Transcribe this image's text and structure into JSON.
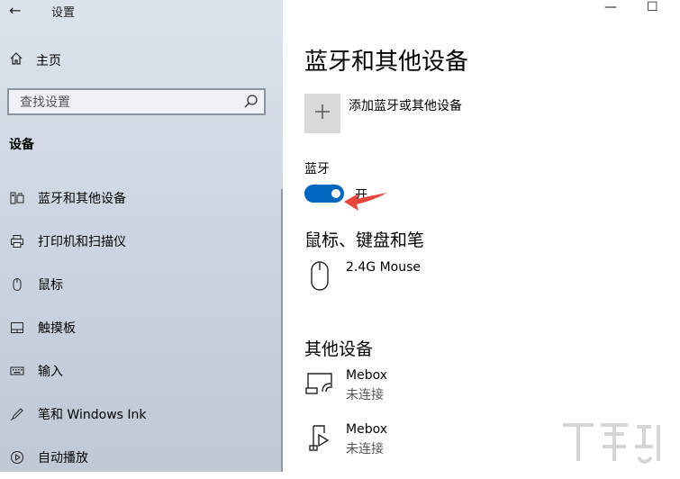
{
  "window": {
    "back_glyph": "←",
    "app_title": "设置",
    "minimize_glyph": "—",
    "maximize_glyph": "☐"
  },
  "sidebar": {
    "home_label": "主页",
    "search_placeholder": "查找设置",
    "section_header": "设备",
    "items": [
      {
        "label": "蓝牙和其他设备",
        "icon": "bluetooth-devices-icon"
      },
      {
        "label": "打印机和扫描仪",
        "icon": "printer-icon"
      },
      {
        "label": "鼠标",
        "icon": "mouse-icon"
      },
      {
        "label": "触摸板",
        "icon": "touchpad-icon"
      },
      {
        "label": "输入",
        "icon": "keyboard-icon"
      },
      {
        "label": "笔和 Windows Ink",
        "icon": "pen-icon"
      },
      {
        "label": "自动播放",
        "icon": "autoplay-icon"
      }
    ]
  },
  "main": {
    "title": "蓝牙和其他设备",
    "add_device_label": "添加蓝牙或其他设备",
    "bluetooth_label": "蓝牙",
    "bluetooth_state": "开",
    "bluetooth_on": true,
    "section_mouse": "鼠标、键盘和笔",
    "mouse_devices": [
      {
        "name": "2.4G Mouse",
        "icon": "mouse-device-icon"
      }
    ],
    "section_other": "其他设备",
    "other_devices": [
      {
        "name": "Mebox",
        "status": "未连接",
        "icon": "wireless-display-icon"
      },
      {
        "name": "Mebox",
        "status": "未连接",
        "icon": "media-device-icon"
      }
    ]
  },
  "colors": {
    "accent": "#0067c0",
    "arrow": "#e8453c"
  }
}
